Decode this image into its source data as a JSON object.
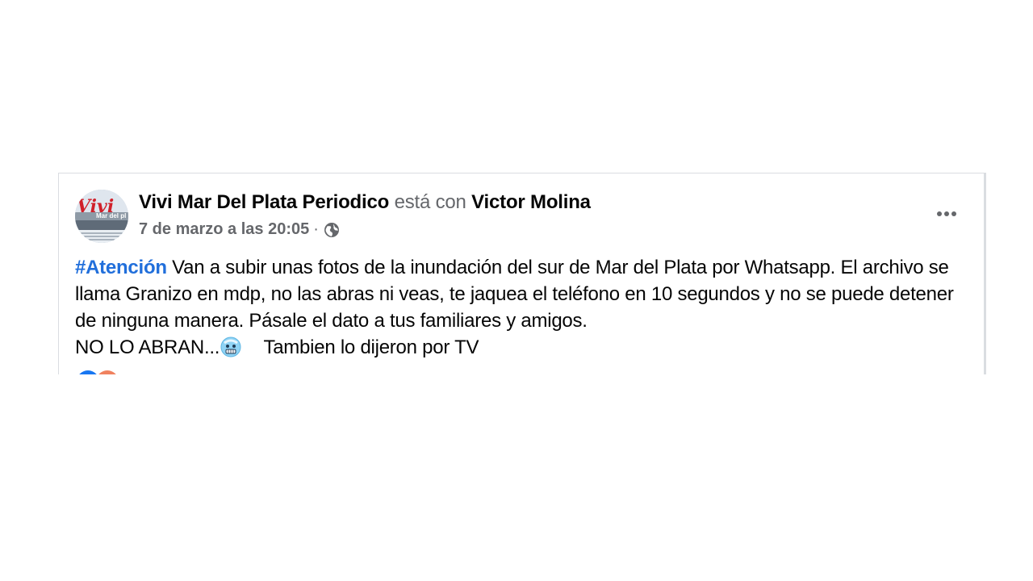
{
  "post": {
    "author": "Vivi Mar Del Plata Periodico",
    "with_text": "está con",
    "tagged": "Victor Molina",
    "timestamp": "7 de marzo a las 20:05",
    "separator": "·",
    "audience_icon": "globe-icon",
    "more_icon": "more-options-icon",
    "avatar_text": "Vivi",
    "avatar_subtext": "Mar del pl",
    "hashtag": "#Atención",
    "body_1": " Van a subir unas fotos de la inundación del sur de Mar del Plata por Whatsapp. El archivo se llama Granizo en mdp, no las abras ni veas, te jaquea el teléfono en 10 segundos y no se puede detener de ninguna manera. Pásale el dato a tus familiares y amigos.",
    "body_2_start": "NO LO ABRAN...",
    "emoji": "cold-face-emoji",
    "body_2_end": "    Tambien lo dijeron por TV"
  },
  "colors": {
    "hashtag": "#216fdb",
    "secondary_text": "#65676b",
    "primary_text": "#050505",
    "border": "#dadde1"
  }
}
